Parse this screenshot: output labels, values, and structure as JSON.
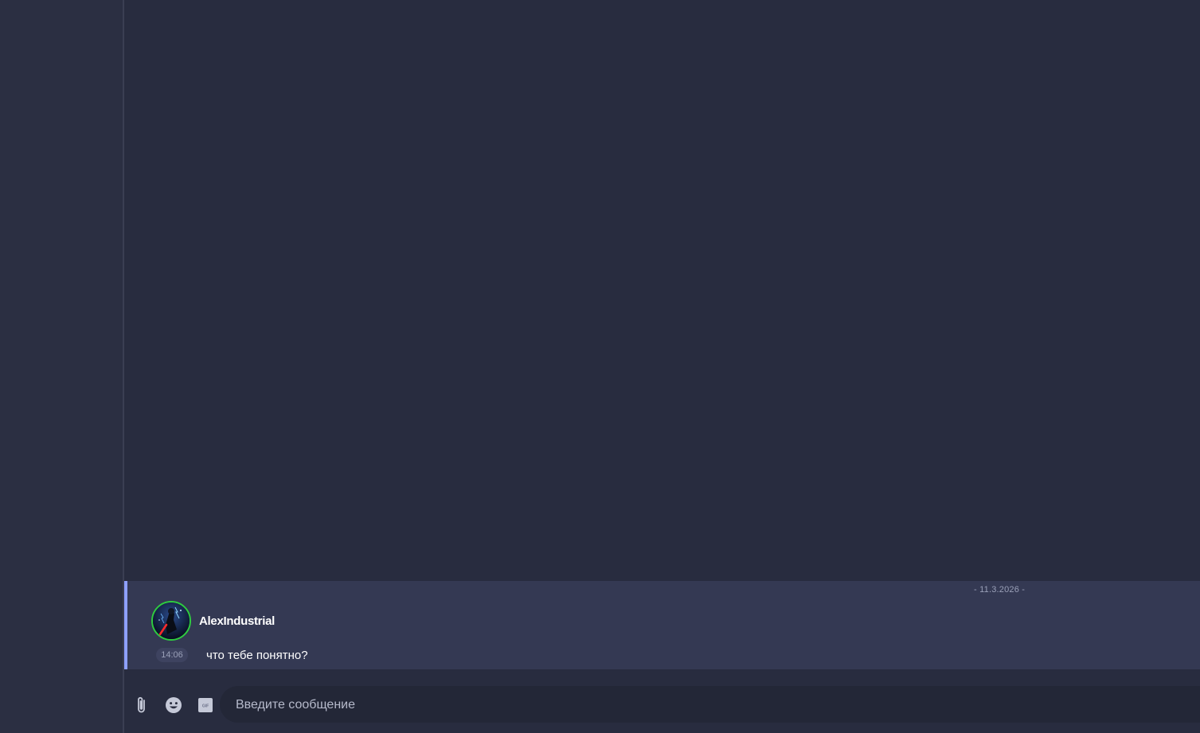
{
  "chat": {
    "date_divider": "- 11.3.2026 -",
    "messages": [
      {
        "author": "AlexIndustrial",
        "time": "14:06",
        "text": "что тебе понятно?"
      }
    ]
  },
  "composer": {
    "placeholder": "Введите сообщение",
    "icons": [
      "paperclip-icon",
      "emoji-icon",
      "gif-icon"
    ]
  },
  "colors": {
    "background": "#282c3f",
    "message_highlight": "#343953",
    "accent_border": "#8ea0ff",
    "avatar_ring": "#2ecc40"
  }
}
